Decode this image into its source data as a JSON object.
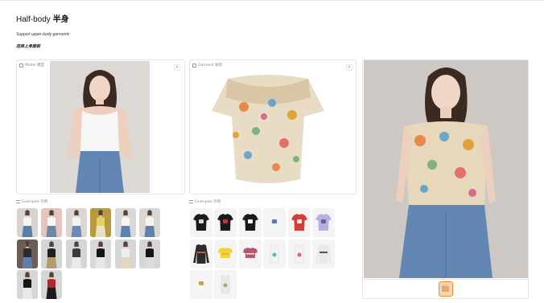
{
  "header": {
    "title_latin": "Half-body",
    "title_cn": "半身",
    "subtitle": "Support upper-body garments",
    "cn_label": "选择上身服装"
  },
  "model_panel": {
    "label": "Model 模型",
    "close": "×"
  },
  "garment_panel": {
    "label": "Garment 服装",
    "close": "×"
  },
  "result_panel": {
    "download": "⇩",
    "close": "×"
  },
  "model_examples": {
    "label": "Examples 示例",
    "items": [
      {
        "bg": "#d8d3cf",
        "top": "#f4f4f2",
        "bottom": "#5b7ea8"
      },
      {
        "bg": "#e6c4be",
        "top": "#f7f7f5",
        "bottom": "#6d87a9"
      },
      {
        "bg": "#d9d6d3",
        "top": "#f2f2f0",
        "bottom": "#6b8bb5"
      },
      {
        "bg": "#b89a3b",
        "top": "#e6d06a",
        "bottom": "#e8e0c8"
      },
      {
        "bg": "#d8d8d8",
        "top": "#f4f4f4",
        "bottom": "#5f82b0"
      },
      {
        "bg": "#dad6d2",
        "top": "#f4f4f4",
        "bottom": "#6180aa"
      },
      {
        "bg": "#6b5d53",
        "top": "#2d2c2c",
        "bottom": "#5d7fa9"
      },
      {
        "bg": "#d5d5d5",
        "top": "#202020",
        "bottom": "#b59b6b"
      },
      {
        "bg": "#d6d6d6",
        "top": "#3b3b3b",
        "bottom": "#e9e9e9"
      },
      {
        "bg": "#d8d8d8",
        "top": "#151515",
        "bottom": "#e8e8e8"
      },
      {
        "bg": "#d6d6d6",
        "top": "#efefef",
        "bottom": "#e4d6c2"
      },
      {
        "bg": "#d6d6d6",
        "top": "#151515",
        "bottom": "#dcdcdc"
      },
      {
        "bg": "#d6d6d6",
        "top": "#151515",
        "bottom": "#e8e8e8"
      },
      {
        "bg": "#d6d6d6",
        "top": "#b8252f",
        "bottom": "#1b1b1b"
      }
    ]
  },
  "garment_examples": {
    "label": "Examples 示例",
    "items": [
      {
        "kind": "tee",
        "color": "#1a1a1a",
        "accent": "#d8d8d8"
      },
      {
        "kind": "tee",
        "color": "#1a1a1a",
        "accent": "#c8302f"
      },
      {
        "kind": "tee",
        "color": "#1a1a1a",
        "accent": "#ffffff"
      },
      {
        "kind": "tee",
        "color": "#f4f4f4",
        "accent": "#3f7fc8"
      },
      {
        "kind": "tee",
        "color": "#d83b3b",
        "accent": "#f5f5f5"
      },
      {
        "kind": "tee",
        "color": "#b9aee0",
        "accent": "#6b5ca8"
      },
      {
        "kind": "long",
        "color": "#2b2b2b",
        "accent": "#c75a3a"
      },
      {
        "kind": "crop",
        "color": "#f2d332",
        "accent": "#e2bb1c"
      },
      {
        "kind": "crop",
        "color": "#b8586d",
        "accent": "#f3f3f3"
      },
      {
        "kind": "tank",
        "color": "#f4f4f4",
        "accent": "#5fb3c2"
      },
      {
        "kind": "tank",
        "color": "#f2f2f2",
        "accent": "#e05b8a"
      },
      {
        "kind": "long",
        "color": "#e8e8e8",
        "accent": "#555555"
      },
      {
        "kind": "tee",
        "color": "#f6f6f6",
        "accent": "#d0a060"
      },
      {
        "kind": "tank",
        "color": "#eaeaea",
        "accent": "#9bb07a"
      }
    ]
  },
  "colors": {
    "accent": "#f08c2e",
    "border": "#e5e5e5"
  }
}
